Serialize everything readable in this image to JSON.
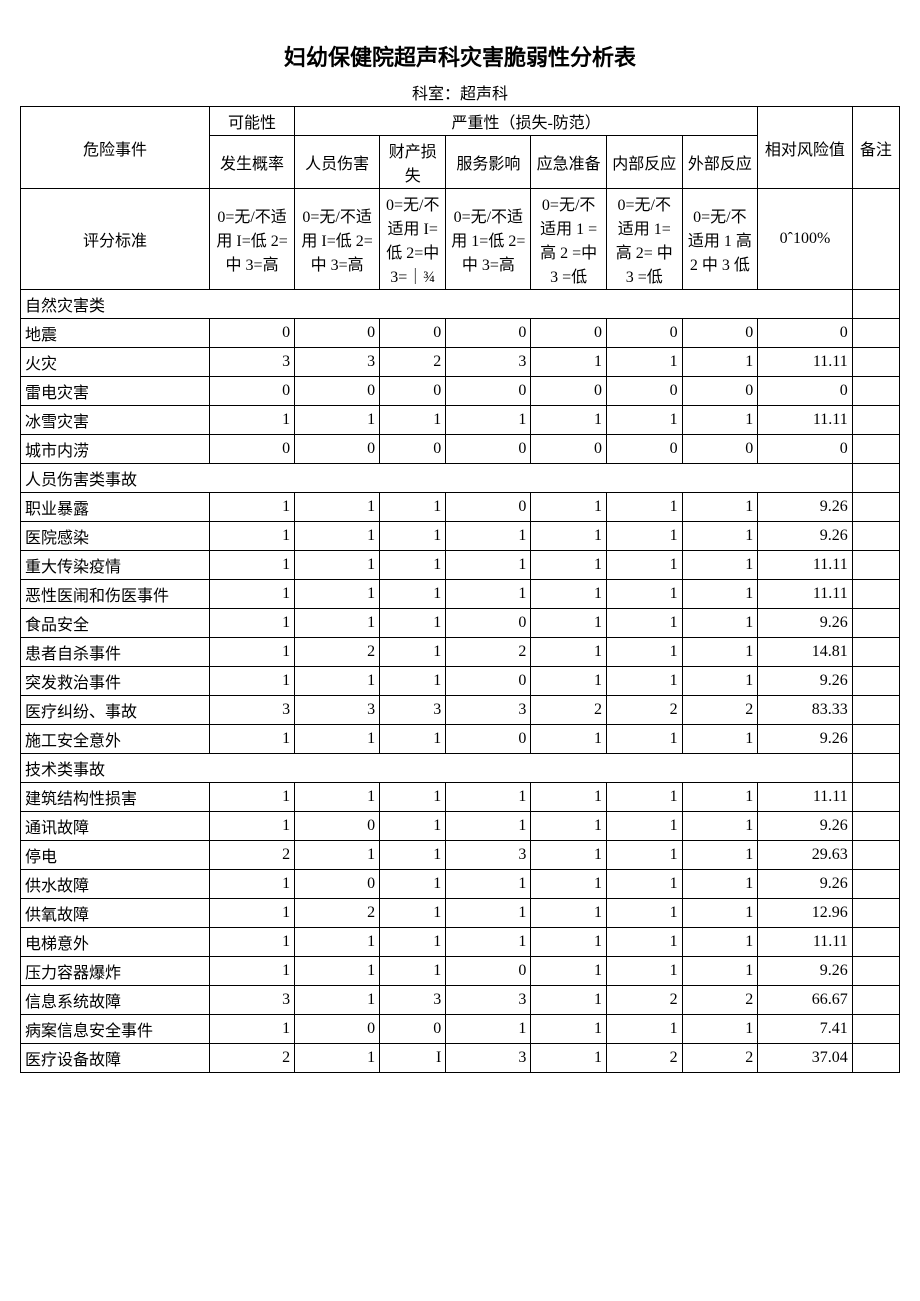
{
  "title": "妇幼保健院超声科灾害脆弱性分析表",
  "subtitle": "科室：超声科",
  "head": {
    "risk_event": "危险事件",
    "possibility": "可能性",
    "severity": "严重性（损失-防范）",
    "prob": "发生概率",
    "injury": "人员伤害",
    "property": "财产损失",
    "service": "服务影响",
    "emergency": "应急准备",
    "internal": "内部反应",
    "external": "外部反应",
    "risk_value": "相对风险值",
    "remark": "备注",
    "criteria": "评分标准",
    "c1": "0=无/不适用 I=低 2=中 3=高",
    "c2": "0=无/不适用 I=低 2=中 3=高",
    "c3": "0=无/不适用 I=低 2=中 3=｜¾",
    "c4": "0=无/不适用 1=低 2=中 3=高",
    "c5": "0=无/不适用 1 =高 2 =中 3 =低",
    "c6": "0=无/不适用 1= 高 2= 中 3 =低",
    "c7": "0=无/不适用 1 高 2 中 3 低",
    "c8": "0ˆ100%"
  },
  "sections": [
    {
      "name": "自然灾害类",
      "rows": [
        {
          "n": "地震",
          "v": [
            "0",
            "0",
            "0",
            "0",
            "0",
            "0",
            "0",
            "0"
          ]
        },
        {
          "n": "火灾",
          "v": [
            "3",
            "3",
            "2",
            "3",
            "1",
            "1",
            "1",
            "11.11"
          ]
        },
        {
          "n": "雷电灾害",
          "v": [
            "0",
            "0",
            "0",
            "0",
            "0",
            "0",
            "0",
            "0"
          ]
        },
        {
          "n": "冰雪灾害",
          "v": [
            "1",
            "1",
            "1",
            "1",
            "1",
            "1",
            "1",
            "11.11"
          ]
        },
        {
          "n": "城市内涝",
          "v": [
            "0",
            "0",
            "0",
            "0",
            "0",
            "0",
            "0",
            "0"
          ]
        }
      ]
    },
    {
      "name": "人员伤害类事故",
      "rows": [
        {
          "n": "职业暴露",
          "v": [
            "1",
            "1",
            "1",
            "0",
            "1",
            "1",
            "1",
            "9.26"
          ]
        },
        {
          "n": "医院感染",
          "v": [
            "1",
            "1",
            "1",
            "1",
            "1",
            "1",
            "1",
            "9.26"
          ]
        },
        {
          "n": "重大传染疫情",
          "v": [
            "1",
            "1",
            "1",
            "1",
            "1",
            "1",
            "1",
            "11.11"
          ]
        },
        {
          "n": "恶性医闹和伤医事件",
          "v": [
            "1",
            "1",
            "1",
            "1",
            "1",
            "1",
            "1",
            "11.11"
          ]
        },
        {
          "n": "食品安全",
          "v": [
            "1",
            "1",
            "1",
            "0",
            "1",
            "1",
            "1",
            "9.26"
          ]
        },
        {
          "n": "患者自杀事件",
          "v": [
            "1",
            "2",
            "1",
            "2",
            "1",
            "1",
            "1",
            "14.81"
          ]
        },
        {
          "n": "突发救治事件",
          "v": [
            "1",
            "1",
            "1",
            "0",
            "1",
            "1",
            "1",
            "9.26"
          ]
        },
        {
          "n": "医疗纠纷、事故",
          "v": [
            "3",
            "3",
            "3",
            "3",
            "2",
            "2",
            "2",
            "83.33"
          ]
        },
        {
          "n": "施工安全意外",
          "v": [
            "1",
            "1",
            "1",
            "0",
            "1",
            "1",
            "1",
            "9.26"
          ]
        }
      ]
    },
    {
      "name": "技术类事故",
      "rows": [
        {
          "n": "建筑结构性损害",
          "v": [
            "1",
            "1",
            "1",
            "1",
            "1",
            "1",
            "1",
            "11.11"
          ]
        },
        {
          "n": "通讯故障",
          "v": [
            "1",
            "0",
            "1",
            "1",
            "1",
            "1",
            "1",
            "9.26"
          ]
        },
        {
          "n": "停电",
          "v": [
            "2",
            "1",
            "1",
            "3",
            "1",
            "1",
            "1",
            "29.63"
          ]
        },
        {
          "n": "供水故障",
          "v": [
            "1",
            "0",
            "1",
            "1",
            "1",
            "1",
            "1",
            "9.26"
          ]
        },
        {
          "n": "供氧故障",
          "v": [
            "1",
            "2",
            "1",
            "1",
            "1",
            "1",
            "1",
            "12.96"
          ]
        },
        {
          "n": "电梯意外",
          "v": [
            "1",
            "1",
            "1",
            "1",
            "1",
            "1",
            "1",
            "11.11"
          ]
        },
        {
          "n": "压力容器爆炸",
          "v": [
            "1",
            "1",
            "1",
            "0",
            "1",
            "1",
            "1",
            "9.26"
          ]
        },
        {
          "n": "信息系统故障",
          "v": [
            "3",
            "1",
            "3",
            "3",
            "1",
            "2",
            "2",
            "66.67"
          ]
        },
        {
          "n": "病案信息安全事件",
          "v": [
            "1",
            "0",
            "0",
            "1",
            "1",
            "1",
            "1",
            "7.41"
          ]
        },
        {
          "n": "医疗设备故障",
          "v": [
            "2",
            "1",
            "I",
            "3",
            "1",
            "2",
            "2",
            "37.04"
          ]
        }
      ]
    }
  ]
}
